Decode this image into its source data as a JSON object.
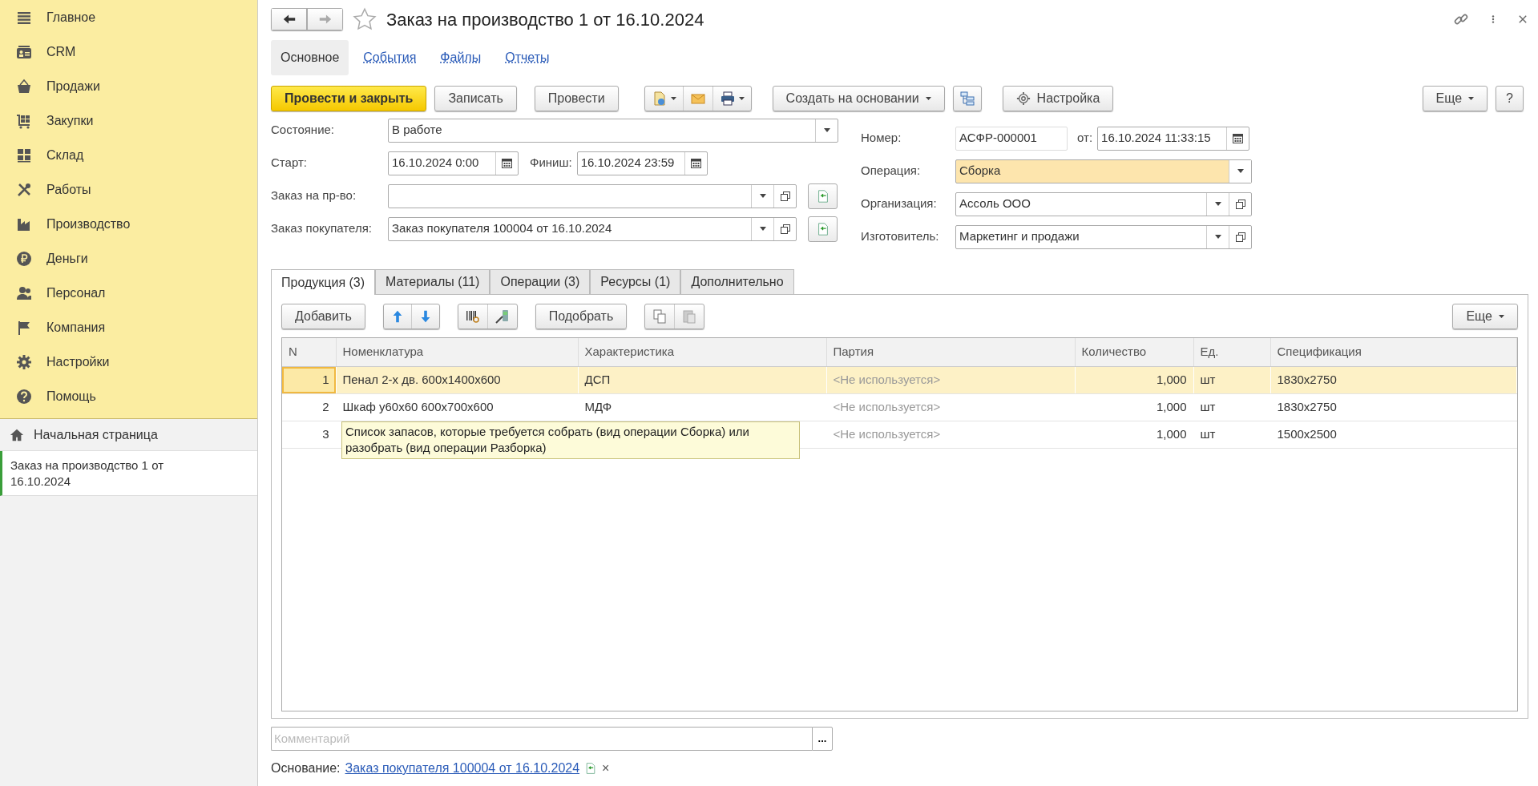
{
  "sidebar": {
    "sections": [
      {
        "label": "Главное"
      },
      {
        "label": "CRM"
      },
      {
        "label": "Продажи"
      },
      {
        "label": "Закупки"
      },
      {
        "label": "Склад"
      },
      {
        "label": "Работы"
      },
      {
        "label": "Производство"
      },
      {
        "label": "Деньги"
      },
      {
        "label": "Персонал"
      },
      {
        "label": "Компания"
      },
      {
        "label": "Настройки"
      },
      {
        "label": "Помощь"
      }
    ],
    "home": {
      "label": "Начальная страница"
    },
    "open_windows": [
      {
        "label": "Заказ на производство 1 от 16.10.2024",
        "selected": true
      }
    ]
  },
  "header": {
    "title": "Заказ на производство 1 от 16.10.2024"
  },
  "nav_tabs": [
    {
      "label": "Основное",
      "selected": true
    },
    {
      "label": "События",
      "selected": false
    },
    {
      "label": "Файлы",
      "selected": false
    },
    {
      "label": "Отчеты",
      "selected": false
    }
  ],
  "toolbar": {
    "post_close": "Провести и закрыть",
    "save": "Записать",
    "post": "Провести",
    "create_based_on": "Создать на основании",
    "settings": "Настройка",
    "more": "Еще",
    "help": "?"
  },
  "form": {
    "state": {
      "label": "Состояние:",
      "value": "В работе"
    },
    "start": {
      "label": "Старт:",
      "value": "16.10.2024  0:00"
    },
    "finish": {
      "label": "Финиш:",
      "value": "16.10.2024 23:59"
    },
    "production_order": {
      "label": "Заказ на пр-во:"
    },
    "customer_order": {
      "label": "Заказ покупателя:",
      "value": "Заказ покупателя 100004 от 16.10.2024"
    },
    "number": {
      "label": "Номер:",
      "value": "АСФР-000001"
    },
    "date": {
      "label": "от:",
      "value": "16.10.2024 11:33:15"
    },
    "operation": {
      "label": "Операция:",
      "value": "Сборка"
    },
    "organization": {
      "label": "Организация:",
      "value": "Ассоль ООО"
    },
    "manufacturer": {
      "label": "Изготовитель:",
      "value": "Маркетинг и продажи"
    }
  },
  "tabs": [
    {
      "label": "Продукция (3)",
      "selected": true
    },
    {
      "label": "Материалы (11)",
      "selected": false
    },
    {
      "label": "Операции (3)",
      "selected": false
    },
    {
      "label": "Ресурсы (1)",
      "selected": false
    },
    {
      "label": "Дополнительно",
      "selected": false
    }
  ],
  "table_toolbar": {
    "add": "Добавить",
    "pick": "Подобрать",
    "more": "Еще"
  },
  "table": {
    "columns": [
      "N",
      "Номенклатура",
      "Характеристика",
      "Партия",
      "Количество",
      "Ед.",
      "Спецификация"
    ],
    "rows": [
      {
        "selected": true,
        "n": "1",
        "nomenclature": "Пенал 2-х дв. 600x1400x600",
        "characteristic": "ДСП",
        "batch": "<Не используется>",
        "quantity": "1,000",
        "unit": "шт",
        "spec": "1830x2750"
      },
      {
        "selected": false,
        "n": "2",
        "nomenclature": "Шкаф у60x60 600x700x600",
        "characteristic": "МДФ",
        "batch": "<Не используется>",
        "quantity": "1,000",
        "unit": "шт",
        "spec": "1830x2750"
      },
      {
        "selected": false,
        "n": "3",
        "batch": "<Не используется>",
        "quantity": "1,000",
        "unit": "шт",
        "spec": "1500x2500"
      }
    ]
  },
  "tooltip": "Список запасов, которые требуется собрать (вид операции Сборка) или разобрать (вид операции Разборка)",
  "comment": {
    "placeholder": "Комментарий",
    "button": "..."
  },
  "basis": {
    "label": "Основание:",
    "link": "Заказ покупателя 100004 от 16.10.2024",
    "remove": "×"
  }
}
